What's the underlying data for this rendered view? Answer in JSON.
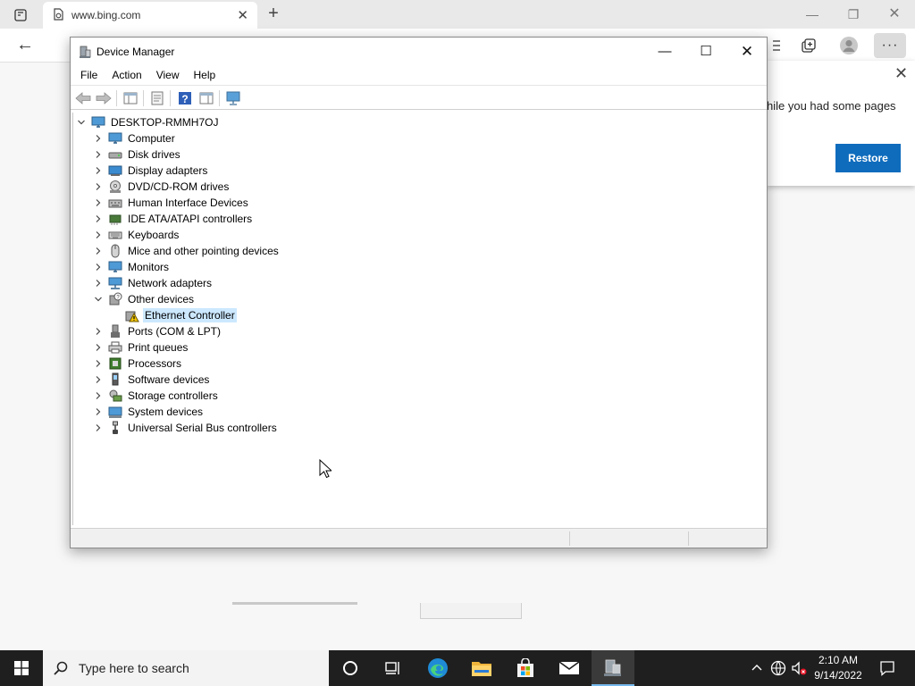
{
  "browser": {
    "tab_title": "www.bing.com",
    "restore_popup": {
      "message": "hile you had some pages",
      "restore_label": "Restore"
    }
  },
  "device_manager": {
    "title": "Device Manager",
    "menu": [
      "File",
      "Action",
      "View",
      "Help"
    ],
    "toolbar": [
      "back-icon",
      "forward-icon",
      "show-hide-console-tree-icon",
      "properties-icon",
      "help-icon",
      "action-pane-icon",
      "scan-hardware-icon"
    ],
    "tree": {
      "root": "DESKTOP-RMMH7OJ",
      "categories": [
        {
          "label": "Computer",
          "icon": "computer-icon",
          "expanded": false
        },
        {
          "label": "Disk drives",
          "icon": "disk-drive-icon",
          "expanded": false
        },
        {
          "label": "Display adapters",
          "icon": "display-adapter-icon",
          "expanded": false
        },
        {
          "label": "DVD/CD-ROM drives",
          "icon": "dvd-drive-icon",
          "expanded": false
        },
        {
          "label": "Human Interface Devices",
          "icon": "hid-icon",
          "expanded": false
        },
        {
          "label": "IDE ATA/ATAPI controllers",
          "icon": "ide-controller-icon",
          "expanded": false
        },
        {
          "label": "Keyboards",
          "icon": "keyboard-icon",
          "expanded": false
        },
        {
          "label": "Mice and other pointing devices",
          "icon": "mouse-icon",
          "expanded": false
        },
        {
          "label": "Monitors",
          "icon": "monitor-icon",
          "expanded": false
        },
        {
          "label": "Network adapters",
          "icon": "network-adapter-icon",
          "expanded": false
        },
        {
          "label": "Other devices",
          "icon": "unknown-device-icon",
          "expanded": true,
          "children": [
            {
              "label": "Ethernet Controller",
              "icon": "warning-device-icon",
              "selected": true
            }
          ]
        },
        {
          "label": "Ports (COM & LPT)",
          "icon": "port-icon",
          "expanded": false
        },
        {
          "label": "Print queues",
          "icon": "printer-icon",
          "expanded": false
        },
        {
          "label": "Processors",
          "icon": "processor-icon",
          "expanded": false
        },
        {
          "label": "Software devices",
          "icon": "software-device-icon",
          "expanded": false
        },
        {
          "label": "Storage controllers",
          "icon": "storage-controller-icon",
          "expanded": false
        },
        {
          "label": "System devices",
          "icon": "system-device-icon",
          "expanded": false
        },
        {
          "label": "Universal Serial Bus controllers",
          "icon": "usb-icon",
          "expanded": false
        }
      ]
    }
  },
  "taskbar": {
    "search_placeholder": "Type here to search",
    "apps": [
      "cortana-icon",
      "task-view-icon",
      "edge-icon",
      "file-explorer-icon",
      "store-icon",
      "mail-icon",
      "device-manager-icon"
    ],
    "active_app": "device-manager-icon",
    "clock_time": "2:10 AM",
    "clock_date": "9/14/2022"
  },
  "colors": {
    "accent": "#0f6cbd",
    "selection": "#cce8ff",
    "taskbar": "#1f1f1f"
  }
}
